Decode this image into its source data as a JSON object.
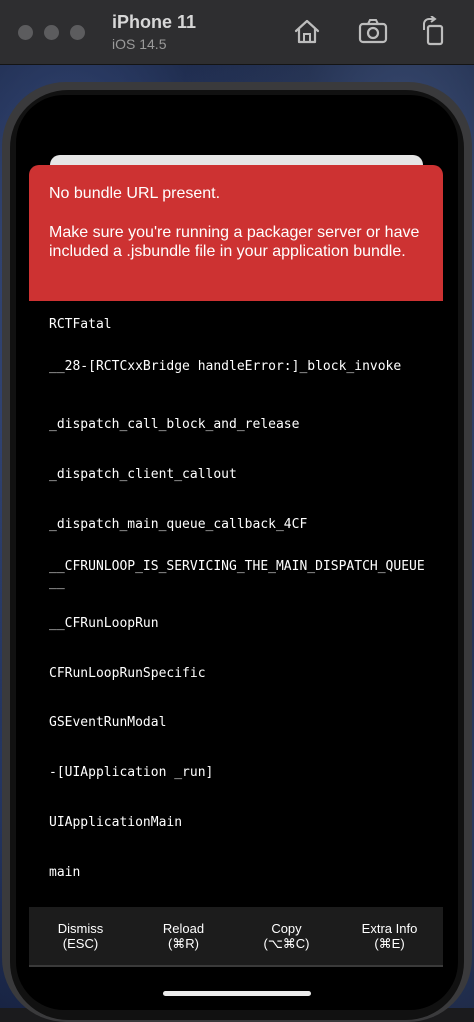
{
  "simulator": {
    "device_name": "iPhone 11",
    "os_version": "iOS 14.5",
    "buttons": [
      "home-icon",
      "screenshot-icon",
      "rotate-icon"
    ]
  },
  "error": {
    "title": "No bundle URL present.",
    "message": "Make sure you're running a packager server or have included a .jsbundle file in your application bundle."
  },
  "stack": [
    "RCTFatal",
    "__28-[RCTCxxBridge handleError:]_block_invoke",
    "_dispatch_call_block_and_release",
    "_dispatch_client_callout",
    "_dispatch_main_queue_callback_4CF",
    "__CFRUNLOOP_IS_SERVICING_THE_MAIN_DISPATCH_QUEUE__",
    "__CFRunLoopRun",
    "CFRunLoopRunSpecific",
    "GSEventRunModal",
    "-[UIApplication _run]",
    "UIApplicationMain",
    "main"
  ],
  "toolbar": {
    "dismiss": {
      "label": "Dismiss",
      "shortcut": "(ESC)"
    },
    "reload": {
      "label": "Reload",
      "shortcut": "(⌘R)"
    },
    "copy": {
      "label": "Copy",
      "shortcut": "(⌥⌘C)"
    },
    "extra": {
      "label": "Extra Info",
      "shortcut": "(⌘E)"
    }
  },
  "colors": {
    "error_red": "#cd3232",
    "background": "#000000",
    "toolbar": "#1c1c1c"
  }
}
